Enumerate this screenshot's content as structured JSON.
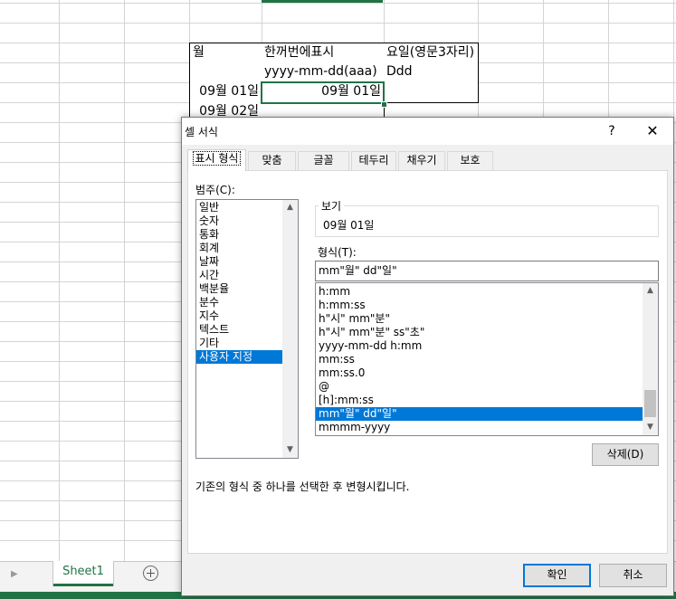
{
  "sheet": {
    "headers": {
      "month": "월",
      "display": "한꺼번에표시",
      "weekday": "요일(영문3자리)"
    },
    "formats": {
      "display": "yyyy-mm-dd(aaa)",
      "weekday": "Ddd"
    },
    "rows": [
      {
        "month": "09월 01일",
        "display": "09월 01일"
      },
      {
        "month": "09월 02일",
        "display": ""
      }
    ],
    "tab_name": "Sheet1",
    "colors": {
      "accent": "#217346"
    }
  },
  "dialog": {
    "title": "셀 서식",
    "help": "?",
    "close": "✕",
    "tabs": [
      {
        "label": "표시 형식"
      },
      {
        "label": "맞춤"
      },
      {
        "label": "글꼴"
      },
      {
        "label": "테두리"
      },
      {
        "label": "채우기"
      },
      {
        "label": "보호"
      }
    ],
    "category_label": "범주(C):",
    "categories": [
      "일반",
      "숫자",
      "통화",
      "회계",
      "날짜",
      "시간",
      "백분율",
      "분수",
      "지수",
      "텍스트",
      "기타",
      "사용자 지정"
    ],
    "selected_category": "사용자 지정",
    "preview_label": "보기",
    "preview_value": "09월 01일",
    "format_label": "형식(T):",
    "format_value": "mm\"월\" dd\"일\"",
    "format_list": [
      "h:mm",
      "h:mm:ss",
      "h\"시\" mm\"분\"",
      "h\"시\" mm\"분\" ss\"초\"",
      "yyyy-mm-dd h:mm",
      "mm:ss",
      "mm:ss.0",
      "@",
      "[h]:mm:ss",
      "mm\"월\" dd\"일\"",
      "mmmm-yyyy"
    ],
    "selected_format": "mm\"월\" dd\"일\"",
    "delete_button": "삭제(D)",
    "description": "기존의 형식 중 하나를 선택한 후 변형시킵니다.",
    "ok_button": "확인",
    "cancel_button": "취소",
    "colors": {
      "selection": "#0078d7"
    }
  }
}
